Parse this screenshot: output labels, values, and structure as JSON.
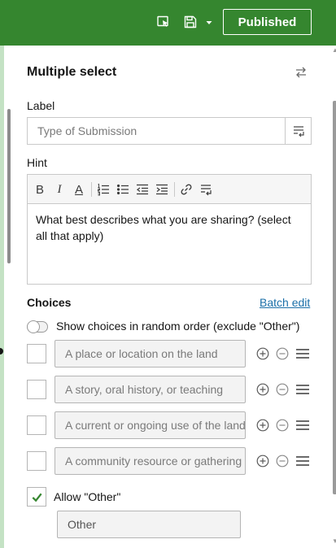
{
  "topbar": {
    "preview_icon": "preview-icon",
    "save_icon": "save-icon",
    "save_menu_icon": "chevron-down-icon",
    "publish_label": "Published",
    "background": "#35862f"
  },
  "panel": {
    "title": "Multiple select",
    "swap_icon": "swap-icon"
  },
  "label_field": {
    "label": "Label",
    "placeholder": "Type of Submission",
    "value": ""
  },
  "hint_field": {
    "label": "Hint",
    "toolbar": [
      "B",
      "I",
      "A",
      "ordered-list",
      "bullet-list",
      "outdent",
      "indent",
      "link",
      "expression"
    ],
    "text": "What best describes what you are sharing? (select all that apply)"
  },
  "choices": {
    "title": "Choices",
    "batch_edit_label": "Batch edit",
    "random_order_label": "Show choices in random order (exclude \"Other\")",
    "random_order_on": false,
    "items": [
      {
        "value": "A place or location on the land",
        "checked": false
      },
      {
        "value": "A story, oral history, or teaching",
        "checked": false
      },
      {
        "value": "A current or ongoing use of the land",
        "checked": false
      },
      {
        "value": "A community resource or gathering place",
        "checked": false
      }
    ],
    "allow_other_label": "Allow \"Other\"",
    "allow_other_checked": true,
    "other_value": "Other"
  }
}
